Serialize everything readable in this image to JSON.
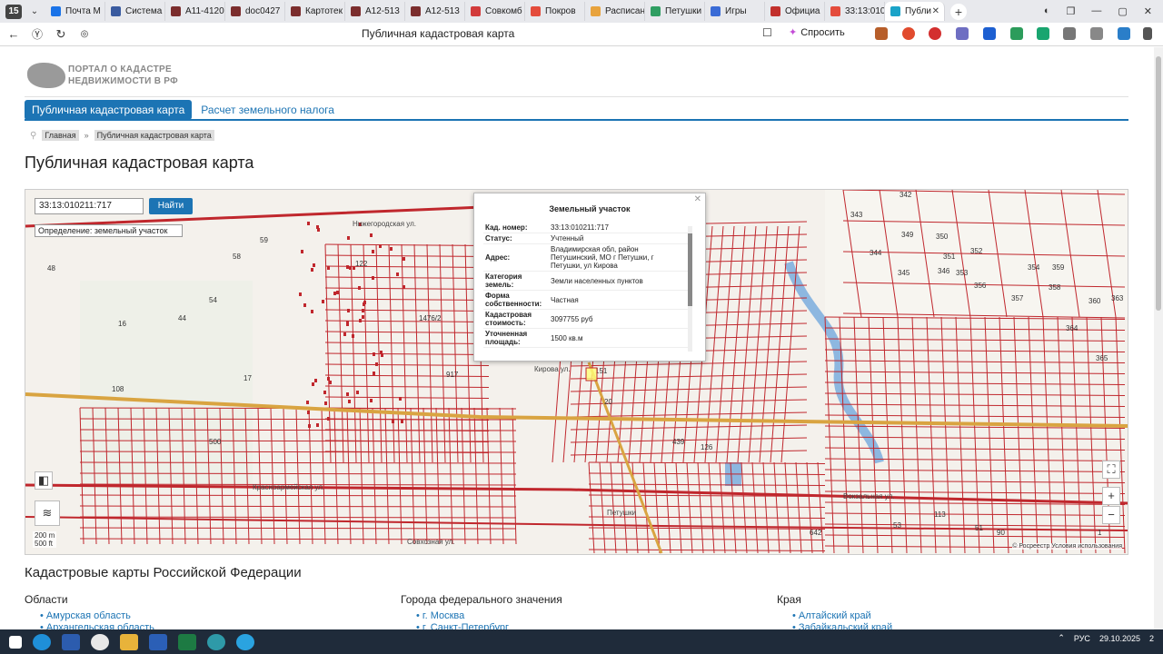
{
  "browser": {
    "tab_counter": "15",
    "tabs": [
      {
        "label": "Почта М",
        "color": "#1a73e8"
      },
      {
        "label": "Система",
        "color": "#3a5ba0"
      },
      {
        "label": "А11-4120",
        "color": "#7b2d2d"
      },
      {
        "label": "doc0427",
        "color": "#7b2d2d"
      },
      {
        "label": "Картотек",
        "color": "#7b2d2d"
      },
      {
        "label": "А12-513",
        "color": "#7b2d2d"
      },
      {
        "label": "А12-513",
        "color": "#7b2d2d"
      },
      {
        "label": "Совкомб",
        "color": "#d23b3b"
      },
      {
        "label": "Покров",
        "color": "#e44c3c"
      },
      {
        "label": "Расписан",
        "color": "#e8a33d"
      },
      {
        "label": "Петушки",
        "color": "#2f9e62"
      },
      {
        "label": "Игры",
        "color": "#3a6bd6"
      },
      {
        "label": "Официа",
        "color": "#c2302c"
      },
      {
        "label": "33:13:010",
        "color": "#e44c3c"
      }
    ],
    "active_tab": {
      "label": "Публи",
      "color": "#1aa3c8"
    },
    "url_title": "Публичная кадастровая карта",
    "ask_label": "Спросить"
  },
  "site": {
    "logo_line1": "ПОРТАЛ О КАДАСТРЕ",
    "logo_line2": "НЕДВИЖИМОСТИ В РФ",
    "nav": {
      "map": "Публичная кадастровая карта",
      "tax": "Расчет земельного налога"
    },
    "breadcrumb": {
      "home": "Главная",
      "current": "Публичная кадастровая карта"
    },
    "title": "Публичная кадастровая карта"
  },
  "map": {
    "search_value": "33:13:010211:717",
    "find_button": "Найти",
    "definition": "Определение:  земельный участок",
    "scale_text": "200 m\n500 ft",
    "attribution": "© Росреестр  Условия использования",
    "labels": [
      "Нижегородская ул.",
      "Красноармейская ул.",
      "Петушки",
      "Вокзальная ул.",
      "Кирова ул.",
      "Совхозная ул."
    ],
    "plots": [
      "59",
      "58",
      "48",
      "54",
      "16",
      "44",
      "108",
      "122",
      "17",
      "342",
      "343",
      "344",
      "345",
      "346",
      "349",
      "350",
      "351",
      "352",
      "353",
      "354",
      "356",
      "357",
      "358",
      "359",
      "360",
      "363",
      "364",
      "365",
      "20",
      "151",
      "439",
      "126",
      "500",
      "917",
      "1476/2",
      "642",
      "113",
      "51",
      "90",
      "53",
      "1"
    ],
    "popup": {
      "title": "Земельный участок",
      "rows": [
        {
          "key": "Кад. номер:",
          "value": "33:13:010211:717"
        },
        {
          "key": "Статус:",
          "value": "Учтенный"
        },
        {
          "key": "Адрес:",
          "value": "Владимирская обл, район Петушинский, МО г Петушки, г Петушки, ул Кирова"
        },
        {
          "key": "Категория земель:",
          "value": "Земли населенных пунктов"
        },
        {
          "key": "Форма собственности:",
          "value": "Частная"
        },
        {
          "key": "Кадастровая стоимость:",
          "value": "3097755 руб"
        },
        {
          "key": "Уточненная площадь:",
          "value": "1500 кв.м"
        }
      ]
    }
  },
  "catalog": {
    "heading": "Кадастровые карты Российской Федерации",
    "regions": {
      "title": "Области",
      "items": [
        "Амурская область",
        "Архангельская область"
      ]
    },
    "cities": {
      "title": "Города федерального значения",
      "items": [
        "г. Москва",
        "г. Санкт-Петербург"
      ]
    },
    "krai": {
      "title": "Края",
      "items": [
        "Алтайский край",
        "Забайкальский край"
      ]
    }
  },
  "taskbar": {
    "lang": "РУС",
    "date": "29.10.2025",
    "notif": "2"
  }
}
